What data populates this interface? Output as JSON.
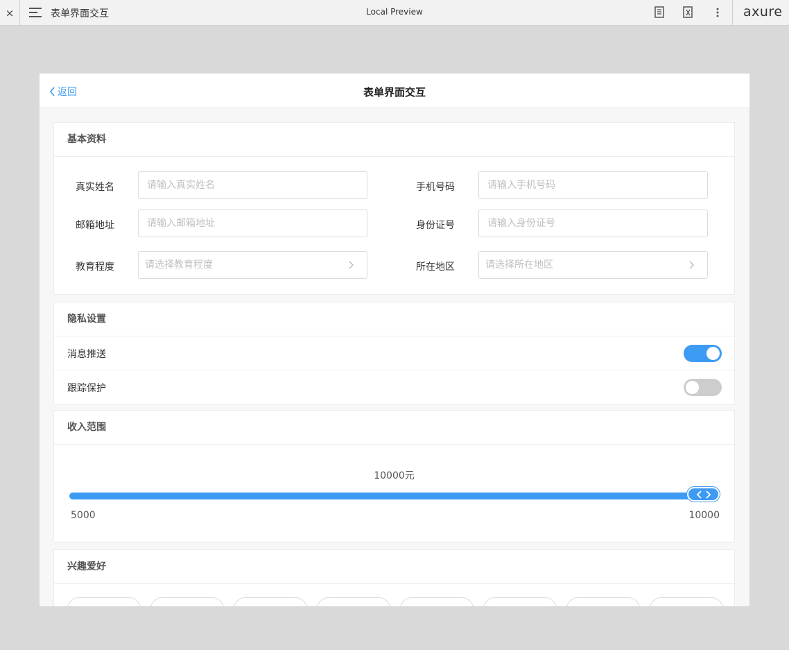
{
  "toolbar": {
    "close_glyph": "×",
    "doc_title": "表单界面交互",
    "preview_label": "Local Preview",
    "logo_text": "axure"
  },
  "nav": {
    "back_label": "返回",
    "title": "表单界面交互"
  },
  "basic_info": {
    "section_title": "基本资料",
    "fields": {
      "name": {
        "label": "真实姓名",
        "placeholder": "请输入真实姓名",
        "value": ""
      },
      "phone": {
        "label": "手机号码",
        "placeholder": "请输入手机号码",
        "value": ""
      },
      "email": {
        "label": "邮箱地址",
        "placeholder": "请输入邮箱地址",
        "value": ""
      },
      "id_number": {
        "label": "身份证号",
        "placeholder": "请输入身份证号",
        "value": ""
      },
      "education": {
        "label": "教育程度",
        "placeholder": "请选择教育程度"
      },
      "region": {
        "label": "所在地区",
        "placeholder": "请选择所在地区"
      }
    }
  },
  "privacy": {
    "section_title": "隐私设置",
    "push": {
      "label": "消息推送",
      "on": true
    },
    "tracking": {
      "label": "跟踪保护",
      "on": false
    }
  },
  "income": {
    "section_title": "收入范围",
    "value_text": "10000元",
    "min_label": "5000",
    "max_label": "10000",
    "min": 5000,
    "max": 10000,
    "value": 10000
  },
  "hobbies": {
    "section_title": "兴趣爱好",
    "tags": [
      "",
      "",
      "",
      "",
      "",
      "",
      "",
      ""
    ]
  },
  "colors": {
    "accent": "#3e9bf4",
    "switch_off": "#cdcdcd"
  }
}
